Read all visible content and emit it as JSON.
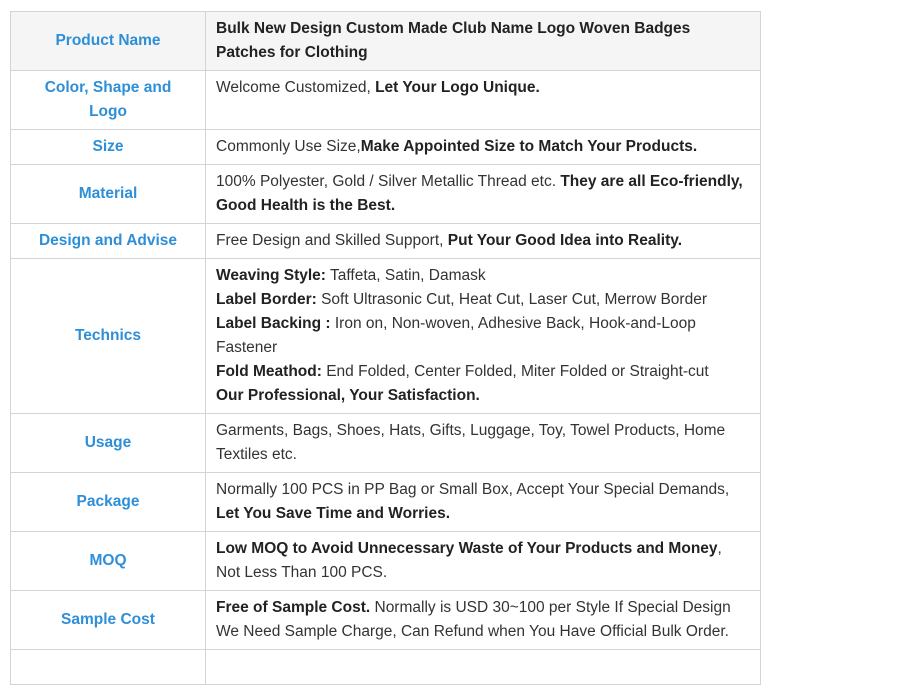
{
  "rows": [
    {
      "label": "Product Name",
      "header": true,
      "lines": [
        [
          {
            "t": "Bulk New Design Custom Made Club Name Logo Woven Badges Patches for Clothing",
            "b": true
          }
        ]
      ]
    },
    {
      "label": "Color, Shape and Logo",
      "lines": [
        [
          {
            "t": "Welcome Customized, "
          },
          {
            "t": "Let Your Logo Unique.",
            "b": true
          }
        ]
      ]
    },
    {
      "label": "Size",
      "lines": [
        [
          {
            "t": "Commonly Use Size,"
          },
          {
            "t": "Make Appointed Size to Match Your Products.",
            "b": true
          }
        ]
      ]
    },
    {
      "label": "Material",
      "lines": [
        [
          {
            "t": "100% Polyester, Gold / Silver Metallic Thread etc. "
          },
          {
            "t": "They are all Eco-friendly, Good Health is the Best.",
            "b": true
          }
        ]
      ]
    },
    {
      "label": "Design and Advise",
      "lines": [
        [
          {
            "t": "Free Design and Skilled Support, "
          },
          {
            "t": "Put Your Good Idea into Reality.",
            "b": true
          }
        ]
      ]
    },
    {
      "label": "Technics",
      "lines": [
        [
          {
            "t": "Weaving Style:",
            "b": true
          },
          {
            "t": " Taffeta, Satin, Damask"
          }
        ],
        [
          {
            "t": "Label Border:",
            "b": true
          },
          {
            "t": " Soft Ultrasonic Cut, Heat Cut, Laser Cut, Merrow Border"
          }
        ],
        [
          {
            "t": "Label Backing :",
            "b": true
          },
          {
            "t": " Iron on, Non-woven, Adhesive Back, Hook-and-Loop Fastener"
          }
        ],
        [
          {
            "t": "Fold Meathod:",
            "b": true
          },
          {
            "t": " End Folded, Center Folded, Miter Folded or Straight-cut"
          }
        ],
        [
          {
            "t": "Our Professional, Your Satisfaction.",
            "b": true
          }
        ]
      ]
    },
    {
      "label": "Usage",
      "lines": [
        [
          {
            "t": "Garments, Bags, Shoes, Hats, Gifts, Luggage, Toy, Towel Products, Home Textiles etc."
          }
        ]
      ]
    },
    {
      "label": "Package",
      "lines": [
        [
          {
            "t": "Normally 100 PCS in PP Bag or Small Box, Accept Your Special Demands, "
          },
          {
            "t": "Let You Save Time and Worries.",
            "b": true
          }
        ]
      ]
    },
    {
      "label": "MOQ",
      "lines": [
        [
          {
            "t": "Low MOQ to Avoid Unnecessary Waste of Your Products and Money",
            "b": true
          },
          {
            "t": ", Not Less Than 100 PCS."
          }
        ]
      ]
    },
    {
      "label": "Sample Cost",
      "lines": [
        [
          {
            "t": "Free of Sample Cost.",
            "b": true
          },
          {
            "t": " Normally is USD 30~100 per Style If Special Design We Need Sample Charge, Can Refund when You Have Official Bulk Order."
          }
        ]
      ]
    },
    {
      "label": "",
      "lines": []
    }
  ]
}
